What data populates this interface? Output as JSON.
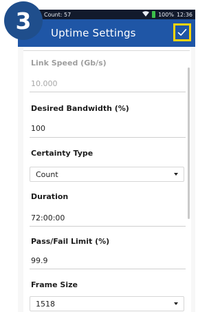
{
  "step_badge": "3",
  "status_bar": {
    "left_text": "Count: 57",
    "battery": "100%",
    "time": "12:36"
  },
  "header": {
    "title": "Uptime Settings"
  },
  "fields": {
    "link_speed": {
      "label": "Link Speed (Gb/s)",
      "value": "10.000"
    },
    "desired_bandwidth": {
      "label": "Desired Bandwidth (%)",
      "value": "100"
    },
    "certainty_type": {
      "label": "Certainty Type",
      "value": "Count"
    },
    "duration": {
      "label": "Duration",
      "value": "72:00:00"
    },
    "pass_fail_limit": {
      "label": "Pass/Fail Limit (%)",
      "value": "99.9"
    },
    "frame_size": {
      "label": "Frame Size",
      "value": "1518"
    }
  },
  "colors": {
    "badge": "#1f4e8c",
    "app_bar": "#1f56a6",
    "status_bar": "#121a2c",
    "highlight": "#ffd500",
    "battery": "#3cc04a"
  },
  "icons": [
    "wifi-icon",
    "battery-icon",
    "check-icon",
    "chevron-down-icon"
  ]
}
